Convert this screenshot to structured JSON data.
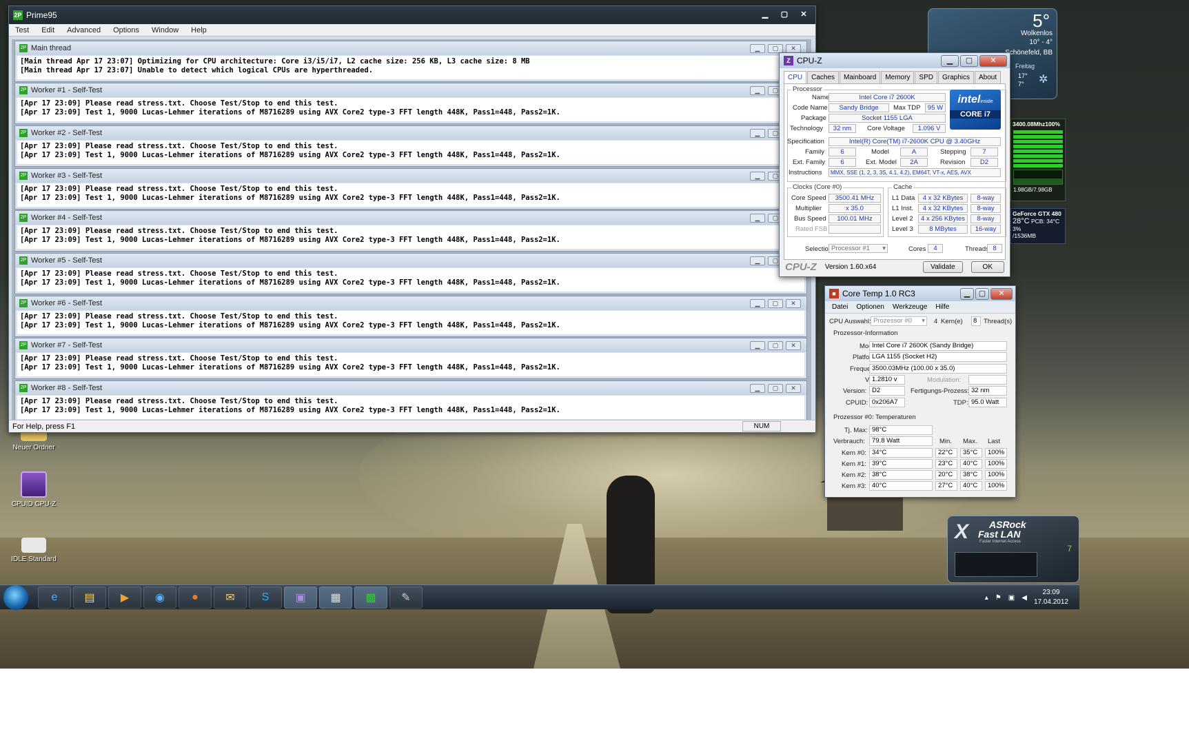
{
  "prime95": {
    "title": "Prime95",
    "menu": [
      "Test",
      "Edit",
      "Advanced",
      "Options",
      "Window",
      "Help"
    ],
    "windows": [
      {
        "title": "Main thread",
        "lines": [
          "[Main thread Apr 17 23:07] Optimizing for CPU architecture: Core i3/i5/i7, L2 cache size: 256 KB, L3 cache size: 8 MB",
          "[Main thread Apr 17 23:07] Unable to detect which logical CPUs are hyperthreaded."
        ]
      },
      {
        "title": "Worker #1 - Self-Test",
        "lines": [
          "[Apr 17 23:09] Please read stress.txt.  Choose Test/Stop to end this test.",
          "[Apr 17 23:09] Test 1, 9000 Lucas-Lehmer iterations of M8716289 using AVX Core2 type-3 FFT length 448K, Pass1=448, Pass2=1K."
        ]
      },
      {
        "title": "Worker #2 - Self-Test",
        "lines": [
          "[Apr 17 23:09] Please read stress.txt.  Choose Test/Stop to end this test.",
          "[Apr 17 23:09] Test 1, 9000 Lucas-Lehmer iterations of M8716289 using AVX Core2 type-3 FFT length 448K, Pass1=448, Pass2=1K."
        ]
      },
      {
        "title": "Worker #3 - Self-Test",
        "lines": [
          "[Apr 17 23:09] Please read stress.txt.  Choose Test/Stop to end this test.",
          "[Apr 17 23:09] Test 1, 9000 Lucas-Lehmer iterations of M8716289 using AVX Core2 type-3 FFT length 448K, Pass1=448, Pass2=1K."
        ]
      },
      {
        "title": "Worker #4 - Self-Test",
        "lines": [
          "[Apr 17 23:09] Please read stress.txt.  Choose Test/Stop to end this test.",
          "[Apr 17 23:09] Test 1, 9000 Lucas-Lehmer iterations of M8716289 using AVX Core2 type-3 FFT length 448K, Pass1=448, Pass2=1K."
        ]
      },
      {
        "title": "Worker #5 - Self-Test",
        "lines": [
          "[Apr 17 23:09] Please read stress.txt.  Choose Test/Stop to end this test.",
          "[Apr 17 23:09] Test 1, 9000 Lucas-Lehmer iterations of M8716289 using AVX Core2 type-3 FFT length 448K, Pass1=448, Pass2=1K."
        ]
      },
      {
        "title": "Worker #6 - Self-Test",
        "lines": [
          "[Apr 17 23:09] Please read stress.txt.  Choose Test/Stop to end this test.",
          "[Apr 17 23:09] Test 1, 9000 Lucas-Lehmer iterations of M8716289 using AVX Core2 type-3 FFT length 448K, Pass1=448, Pass2=1K."
        ]
      },
      {
        "title": "Worker #7 - Self-Test",
        "lines": [
          "[Apr 17 23:09] Please read stress.txt.  Choose Test/Stop to end this test.",
          "[Apr 17 23:09] Test 1, 9000 Lucas-Lehmer iterations of M8716289 using AVX Core2 type-3 FFT length 448K, Pass1=448, Pass2=1K."
        ]
      },
      {
        "title": "Worker #8 - Self-Test",
        "lines": [
          "[Apr 17 23:09] Please read stress.txt.  Choose Test/Stop to end this test.",
          "[Apr 17 23:09] Test 1, 9000 Lucas-Lehmer iterations of M8716289 using AVX Core2 type-3 FFT length 448K, Pass1=448, Pass2=1K."
        ]
      }
    ],
    "status": "For Help, press F1",
    "num": "NUM"
  },
  "cpuz": {
    "title": "CPU-Z",
    "tabs": [
      "CPU",
      "Caches",
      "Mainboard",
      "Memory",
      "SPD",
      "Graphics",
      "About"
    ],
    "processor_legend": "Processor",
    "name_label": "Name",
    "name": "Intel Core i7 2600K",
    "codename_label": "Code Name",
    "codename": "Sandy Bridge",
    "maxtdp_label": "Max TDP",
    "maxtdp": "95 W",
    "package_label": "Package",
    "package": "Socket 1155 LGA",
    "technology_label": "Technology",
    "technology": "32 nm",
    "corevoltage_label": "Core Voltage",
    "corevoltage": "1.096 V",
    "spec_label": "Specification",
    "spec": "Intel(R) Core(TM) i7-2600K CPU @ 3.40GHz",
    "family_label": "Family",
    "family": "6",
    "model_label": "Model",
    "model": "A",
    "stepping_label": "Stepping",
    "stepping": "7",
    "extfamily_label": "Ext. Family",
    "extfamily": "6",
    "extmodel_label": "Ext. Model",
    "extmodel": "2A",
    "revision_label": "Revision",
    "revision": "D2",
    "instructions_label": "Instructions",
    "instructions": "MMX, SSE (1, 2, 3, 3S, 4.1, 4.2), EM64T, VT-x, AES, AVX",
    "intel_brand": "intel",
    "intel_inside": "inside",
    "intel_core": "CORE i7",
    "clocks_legend": "Clocks (Core #0)",
    "corespeed_label": "Core Speed",
    "corespeed": "3500.41 MHz",
    "multiplier_label": "Multiplier",
    "multiplier": "x 35.0",
    "busspeed_label": "Bus Speed",
    "busspeed": "100.01 MHz",
    "ratedfsb_label": "Rated FSB",
    "ratedfsb": "",
    "cache_legend": "Cache",
    "l1data_label": "L1 Data",
    "l1data": "4 x 32 KBytes",
    "l1data_way": "8-way",
    "l1inst_label": "L1 Inst.",
    "l1inst": "4 x 32 KBytes",
    "l1inst_way": "8-way",
    "level2_label": "Level 2",
    "level2": "4 x 256 KBytes",
    "level2_way": "8-way",
    "level3_label": "Level 3",
    "level3": "8 MBytes",
    "level3_way": "16-way",
    "selection_label": "Selection",
    "selection": "Processor #1",
    "cores_label": "Cores",
    "cores": "4",
    "threads_label": "Threads",
    "threads": "8",
    "logo": "CPU-Z",
    "version": "Version 1.60.x64",
    "validate": "Validate",
    "ok": "OK"
  },
  "coretemp": {
    "title": "Core Temp 1.0 RC3",
    "menu": [
      "Datei",
      "Optionen",
      "Werkzeuge",
      "Hilfe"
    ],
    "cpu_select_label": "CPU Auswahl:",
    "cpu_select": "Prozessor #0",
    "kerne_count": "4",
    "kerne_label": "Kern(e)",
    "threads_count": "8",
    "threads_label": "Thread(s)",
    "info_legend": "Prozessor-Information",
    "model_label": "Model:",
    "model": "Intel Core i7 2600K (Sandy Bridge)",
    "platform_label": "Platform:",
    "platform": "LGA 1155 (Socket H2)",
    "freq_label": "Frequenz:",
    "freq": "3500.03MHz (100.00 x 35.0)",
    "vid_label": "VID:",
    "vid": "1.2810 v",
    "modulation_label": "Modulation:",
    "modulation": "",
    "version_label": "Version:",
    "version": "D2",
    "process_label": "Fertigungs-Prozess:",
    "process": "32 nm",
    "cpuid_label": "CPUID:",
    "cpuid": "0x206A7",
    "tdp_label": "TDP:",
    "tdp": "95.0 Watt",
    "temp_legend": "Prozessor #0: Temperaturen",
    "tjmax_label": "Tj. Max:",
    "tjmax": "98°C",
    "power_label": "Verbrauch:",
    "power": "79.8 Watt",
    "col_min": "Min.",
    "col_max": "Max.",
    "col_last": "Last",
    "cores": [
      {
        "label": "Kern #0:",
        "temp": "34°C",
        "min": "22°C",
        "max": "35°C",
        "load": "100%"
      },
      {
        "label": "Kern #1:",
        "temp": "39°C",
        "min": "23°C",
        "max": "40°C",
        "load": "100%"
      },
      {
        "label": "Kern #2:",
        "temp": "38°C",
        "min": "20°C",
        "max": "38°C",
        "load": "100%"
      },
      {
        "label": "Kern #3:",
        "temp": "40°C",
        "min": "27°C",
        "max": "40°C",
        "load": "100%"
      }
    ]
  },
  "weather": {
    "temp": "5°",
    "condition": "Wolkenlos",
    "range": "10° - 4°",
    "city": "Schönefeld, BB",
    "day": "Freitag",
    "day_high": "17°",
    "day_low": "7°"
  },
  "resmon": {
    "header": "3400.08Mhz100%",
    "memory": "1.98GB/7.98GB"
  },
  "gpu": {
    "name": "GeForce GTX 480",
    "temp": "28°C",
    "pcb": "PCB: 34°C",
    "usage": "3%",
    "mem": "/1536MB"
  },
  "asrock": {
    "brand": "ASRock",
    "product": "Fast LAN",
    "tagline": "Faster Internet Access",
    "count": "7"
  },
  "desktop_icons": [
    {
      "label": "Neuer Ordner"
    },
    {
      "label": "CPUID CPU-Z"
    },
    {
      "label": "IDLE Standard"
    }
  ],
  "taskbar": {
    "time": "23:09",
    "date": "17.04.2012"
  },
  "colors": {
    "prime_title": "#1f2a33",
    "cpuz_value": "#1a3aa8",
    "intel_blue": "#0b3f8e"
  }
}
